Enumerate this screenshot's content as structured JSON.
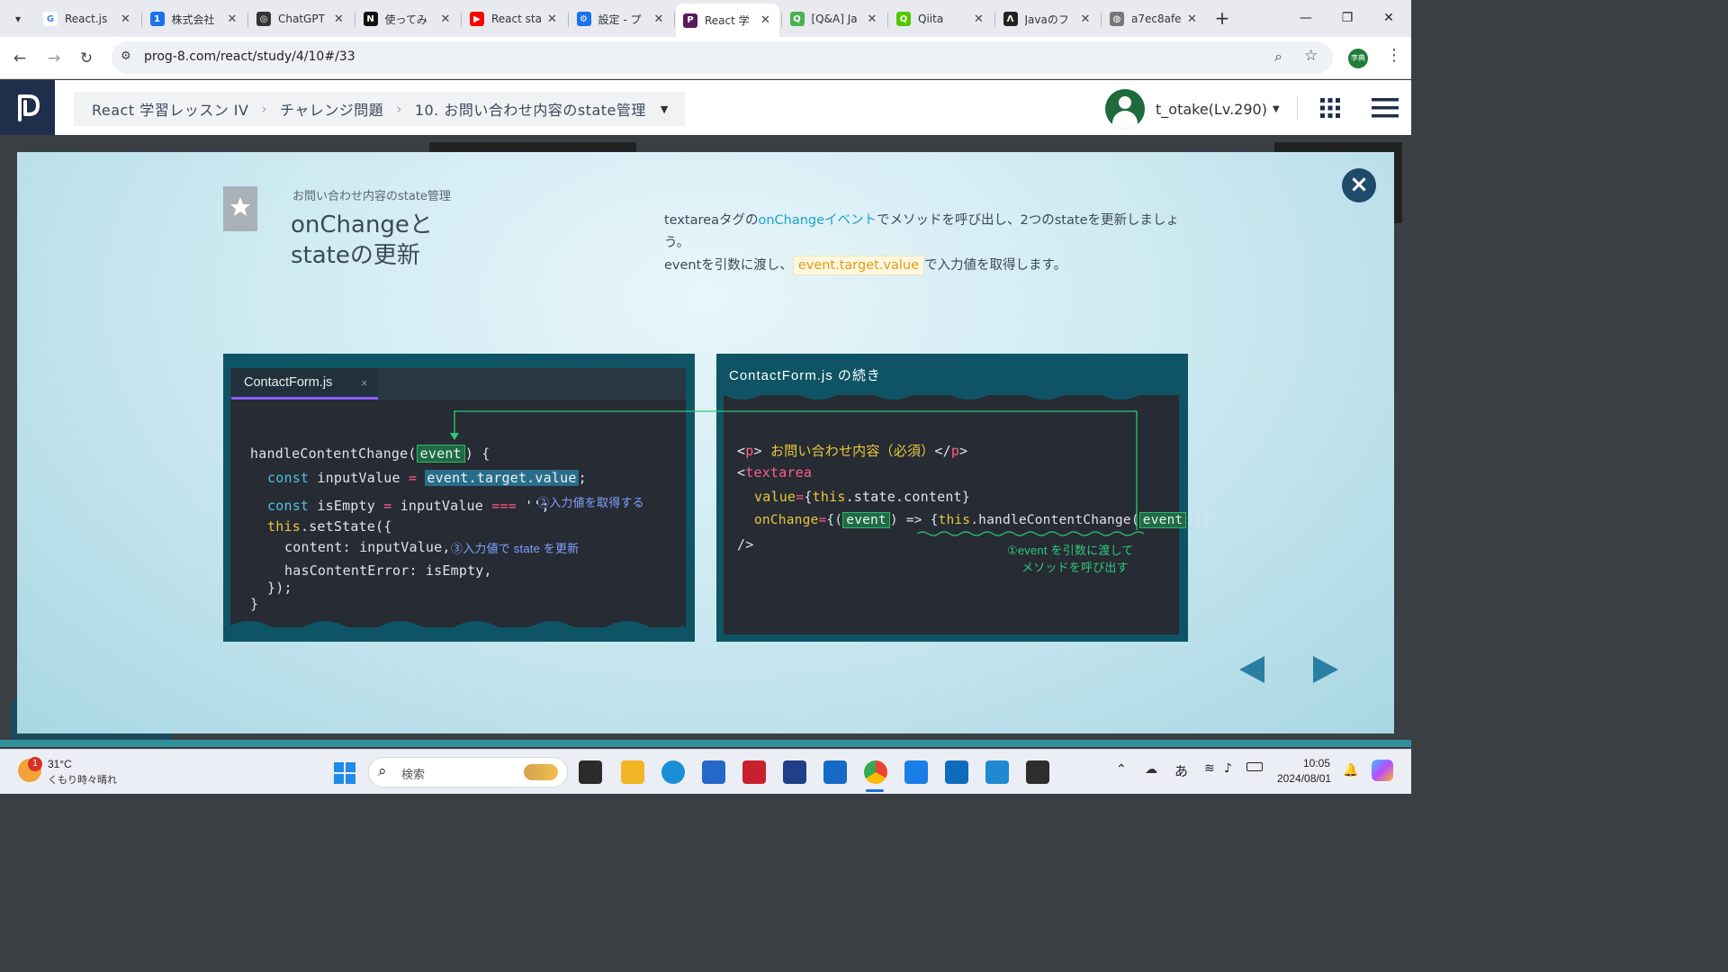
{
  "browser": {
    "tabs": [
      {
        "title": "React.js",
        "fav": "G",
        "color": "#ffffff"
      },
      {
        "title": "株式会社",
        "fav": "1",
        "color": "#1a73e8"
      },
      {
        "title": "ChatGPT",
        "fav": "◎",
        "color": "#333333"
      },
      {
        "title": "使ってみ",
        "fav": "N",
        "color": "#111111"
      },
      {
        "title": "React sta",
        "fav": "▶",
        "color": "#ff0000"
      },
      {
        "title": "設定 - プ",
        "fav": "⚙",
        "color": "#1a73e8"
      },
      {
        "title": "React 学",
        "fav": "P",
        "color": "#5a1a5a",
        "active": true
      },
      {
        "title": "[Q&A] Ja",
        "fav": "Q",
        "color": "#4caf50"
      },
      {
        "title": "Qiita",
        "fav": "Q",
        "color": "#55c500"
      },
      {
        "title": "Javaのフ",
        "fav": "Λ",
        "color": "#222222"
      },
      {
        "title": "a7ec8afe",
        "fav": "◍",
        "color": "#777777"
      }
    ],
    "new_tab": "+",
    "url": "prog-8.com/react/study/4/10#/33",
    "profile_initials": "李典"
  },
  "header": {
    "breadcrumbs": [
      "React 学習レッスン IV",
      "チャレンジ問題",
      "10. お問い合わせ内容のstate管理"
    ],
    "username": "t_otake(Lv.290)"
  },
  "slide": {
    "subtitle": "お問い合わせ内容のstate管理",
    "title_line1": "onChangeと",
    "title_line2": "stateの更新",
    "desc_a": "textareaタグの",
    "desc_link": "onChangeイベント",
    "desc_b": "でメソッドを呼び出し、2つのstateを更新しましょう。",
    "desc_c": "eventを引数に渡し、",
    "desc_code": "event.target.value",
    "desc_d": "で入力値を取得します。",
    "left_tab": "ContactForm.js",
    "left_tab_close": "×",
    "right_title": "ContactForm.js の続き",
    "code_left": {
      "l1a": "handleContentChange(",
      "l1b": "event",
      "l1c": ") {",
      "l2a": "const",
      "l2b": " inputValue ",
      "l2c": "=",
      "l2d": "event.target.value",
      "l2e": ";",
      "l3a": "const",
      "l3b": " isEmpty ",
      "l3c": "=",
      "l3d": " inputValue ",
      "l3e": "===",
      "l3f": " '';",
      "l4a": "this",
      "l4b": ".setState({",
      "l5": "content: inputValue,",
      "l6": "hasContentError: isEmpty,",
      "l7": "});",
      "l8": "}"
    },
    "code_right": {
      "l1a": "<",
      "l1b": "p",
      "l1c": "> ",
      "l1d": "お問い合わせ内容（必須）",
      "l1e": "</",
      "l1f": "p",
      "l1g": ">",
      "l2a": "<",
      "l2b": "textarea",
      "l3a": "value",
      "l3b": "=",
      "l3c": "{",
      "l3d": "this",
      "l3e": ".state.content}",
      "l4a": "onChange",
      "l4b": "=",
      "l4c": "{(",
      "l4d": "event",
      "l4e": ") => {",
      "l4f": "this",
      "l4g": ".handleContentChange(",
      "l4h": "event",
      "l4i": ")}}",
      "l5": "/>"
    },
    "note1": "②入力値を取得する",
    "note2": "③入力値で state を更新",
    "note3_line1": "①event を引数に渡して",
    "note3_line2": "メソッドを呼び出す",
    "close_label": "×"
  },
  "taskbar": {
    "weather_temp": "31°C",
    "weather_desc": "くもり時々晴れ",
    "weather_badge": "1",
    "search_placeholder": "検索",
    "ime": "あ",
    "time": "10:05",
    "date": "2024/08/01"
  },
  "colors": {
    "accent_teal": "#0f5464",
    "code_bg": "#272b33",
    "link_blue": "#1aa0d0",
    "highlight_green": "#1f6b45"
  }
}
